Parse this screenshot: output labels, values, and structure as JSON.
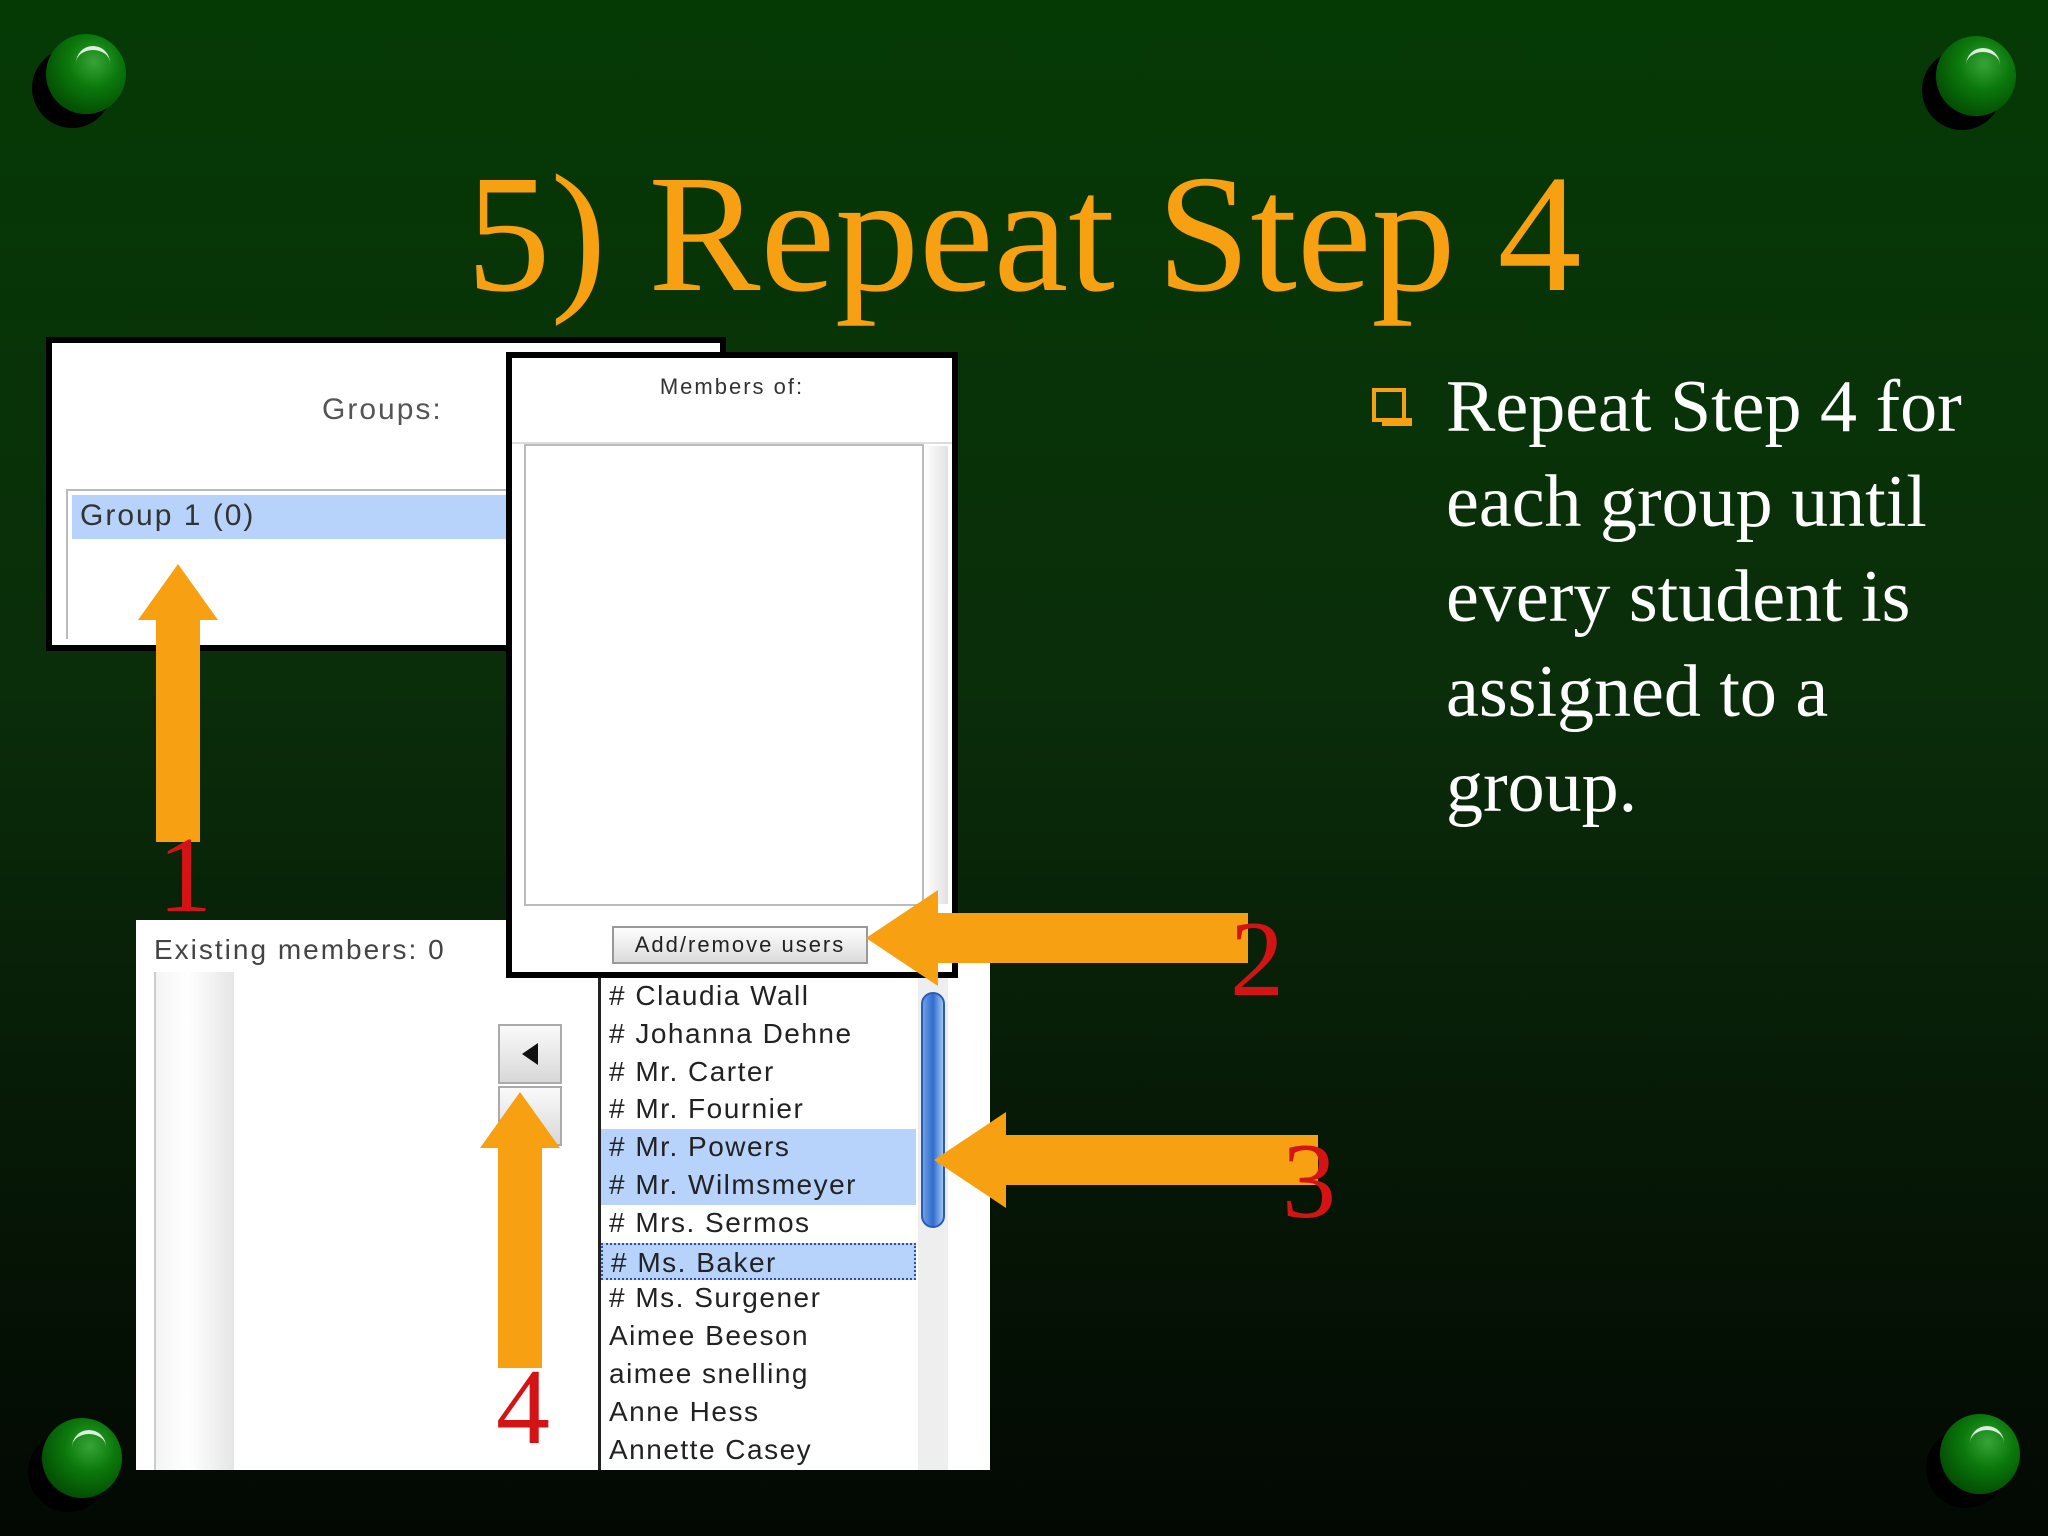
{
  "slide": {
    "title": "5) Repeat Step 4",
    "bullet": "Repeat Step 4 for each group until every student is assigned to a group."
  },
  "groups_panel": {
    "label": "Groups:",
    "items": [
      "Group 1 (0)"
    ]
  },
  "members_panel": {
    "label": "Members of:",
    "button": "Add/remove users"
  },
  "existing_panel": {
    "label": "Existing members: 0",
    "users": [
      {
        "name": "# Claudia Wall",
        "state": "normal"
      },
      {
        "name": "# Johanna Dehne",
        "state": "normal"
      },
      {
        "name": "# Mr. Carter",
        "state": "normal"
      },
      {
        "name": "# Mr. Fournier",
        "state": "normal"
      },
      {
        "name": "# Mr. Powers",
        "state": "selected"
      },
      {
        "name": "# Mr. Wilmsmeyer",
        "state": "selected"
      },
      {
        "name": "# Mrs. Sermos",
        "state": "normal"
      },
      {
        "name": "# Ms. Baker",
        "state": "focused"
      },
      {
        "name": "# Ms. Surgener",
        "state": "normal"
      },
      {
        "name": "Aimee Beeson",
        "state": "normal"
      },
      {
        "name": "aimee snelling",
        "state": "normal"
      },
      {
        "name": "Anne Hess",
        "state": "normal"
      },
      {
        "name": "Annette Casey",
        "state": "normal"
      }
    ]
  },
  "step_numbers": [
    "1",
    "2",
    "3",
    "4"
  ],
  "colors": {
    "accent": "#f7a012",
    "step_number": "#d41414",
    "selection": "#b7d3fb"
  }
}
